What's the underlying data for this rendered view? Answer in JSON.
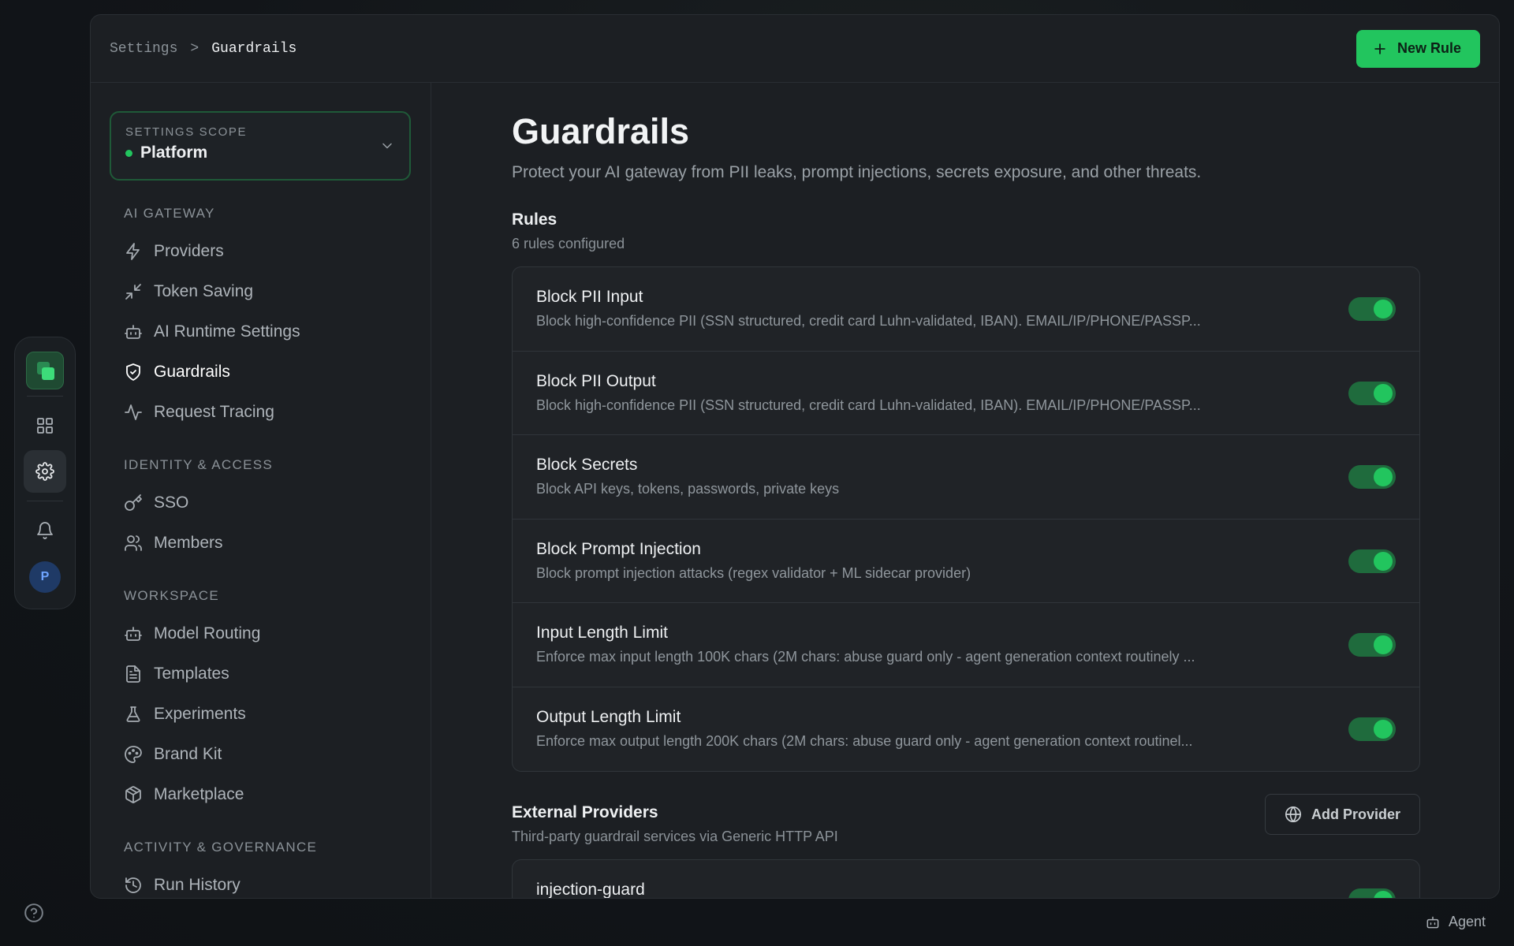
{
  "breadcrumb": {
    "parent": "Settings",
    "separator": ">",
    "current": "Guardrails"
  },
  "header": {
    "new_rule_label": "New Rule"
  },
  "scope": {
    "label": "SETTINGS SCOPE",
    "value": "Platform"
  },
  "sidebar": {
    "groups": [
      {
        "title": "AI GATEWAY",
        "items": [
          {
            "label": "Providers",
            "icon": "zap-icon"
          },
          {
            "label": "Token Saving",
            "icon": "minimize-icon"
          },
          {
            "label": "AI Runtime Settings",
            "icon": "bot-icon"
          },
          {
            "label": "Guardrails",
            "icon": "shield-check-icon",
            "active": true
          },
          {
            "label": "Request Tracing",
            "icon": "activity-icon"
          }
        ]
      },
      {
        "title": "IDENTITY & ACCESS",
        "items": [
          {
            "label": "SSO",
            "icon": "key-icon"
          },
          {
            "label": "Members",
            "icon": "users-icon"
          }
        ]
      },
      {
        "title": "WORKSPACE",
        "items": [
          {
            "label": "Model Routing",
            "icon": "bot-icon"
          },
          {
            "label": "Templates",
            "icon": "file-text-icon"
          },
          {
            "label": "Experiments",
            "icon": "flask-icon"
          },
          {
            "label": "Brand Kit",
            "icon": "palette-icon"
          },
          {
            "label": "Marketplace",
            "icon": "package-icon"
          }
        ]
      },
      {
        "title": "ACTIVITY & GOVERNANCE",
        "items": [
          {
            "label": "Run History",
            "icon": "history-icon"
          }
        ]
      }
    ]
  },
  "rail": {
    "avatar_initial": "P"
  },
  "page": {
    "title": "Guardrails",
    "subtitle": "Protect your AI gateway from PII leaks, prompt injections, secrets exposure, and other threats."
  },
  "rules_section": {
    "title": "Rules",
    "count_text": "6 rules configured"
  },
  "rules": [
    {
      "name": "Block PII Input",
      "description": "Block high-confidence PII (SSN structured, credit card Luhn-validated, IBAN). EMAIL/IP/PHONE/PASSP...",
      "enabled": true
    },
    {
      "name": "Block PII Output",
      "description": "Block high-confidence PII (SSN structured, credit card Luhn-validated, IBAN). EMAIL/IP/PHONE/PASSP...",
      "enabled": true
    },
    {
      "name": "Block Secrets",
      "description": "Block API keys, tokens, passwords, private keys",
      "enabled": true
    },
    {
      "name": "Block Prompt Injection",
      "description": "Block prompt injection attacks (regex validator + ML sidecar provider)",
      "enabled": true
    },
    {
      "name": "Input Length Limit",
      "description": "Enforce max input length 100K chars (2M chars: abuse guard only - agent generation context routinely ...",
      "enabled": true
    },
    {
      "name": "Output Length Limit",
      "description": "Enforce max output length 200K chars (2M chars: abuse guard only - agent generation context routinel...",
      "enabled": true
    }
  ],
  "external": {
    "title": "External Providers",
    "subtitle": "Third-party guardrail services via Generic HTTP API",
    "add_label": "Add Provider",
    "providers": [
      {
        "name": "injection-guard",
        "enabled": true
      }
    ]
  },
  "footer": {
    "agent_label": "Agent"
  },
  "colors": {
    "accent": "#22c55e",
    "toggle_track": "#1f6b3d"
  }
}
